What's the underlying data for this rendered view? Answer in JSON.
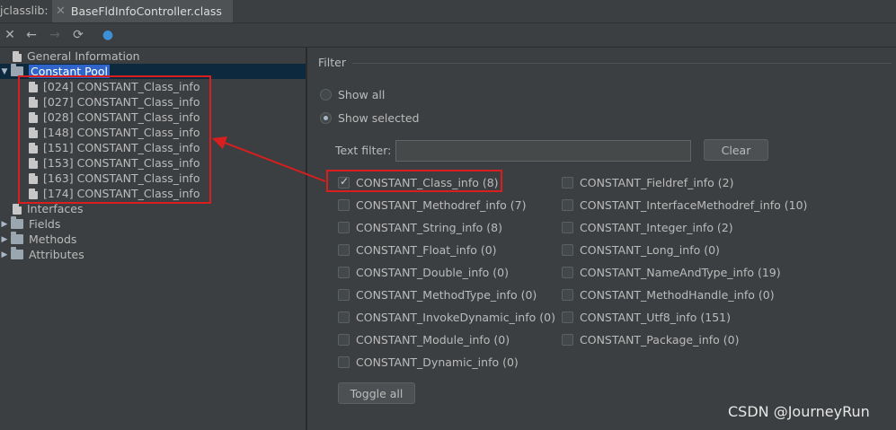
{
  "tabs": {
    "prefix": "jclasslib:",
    "active_title": "BaseFldInfoController.class",
    "close_glyph": "✕"
  },
  "toolbar": {
    "buttons": [
      {
        "name": "close-icon",
        "glyph": "✕"
      },
      {
        "name": "back-arrow-icon",
        "glyph": "←"
      },
      {
        "name": "forward-arrow-icon",
        "glyph": "→"
      },
      {
        "name": "refresh-icon",
        "glyph": "⟳"
      },
      {
        "name": "web-globe-icon",
        "glyph": "●"
      }
    ]
  },
  "tree": {
    "general": "General Information",
    "constant_pool": "Constant Pool",
    "constant_items": [
      "[024] CONSTANT_Class_info",
      "[027] CONSTANT_Class_info",
      "[028] CONSTANT_Class_info",
      "[148] CONSTANT_Class_info",
      "[151] CONSTANT_Class_info",
      "[153] CONSTANT_Class_info",
      "[163] CONSTANT_Class_info",
      "[174] CONSTANT_Class_info"
    ],
    "interfaces": "Interfaces",
    "fields": "Fields",
    "methods": "Methods",
    "attributes": "Attributes"
  },
  "filter": {
    "title": "Filter",
    "show_all": "Show all",
    "show_selected": "Show selected",
    "selected_mode": "show_selected",
    "text_filter_label": "Text filter:",
    "text_filter_value": "",
    "clear_label": "Clear",
    "toggle_all_label": "Toggle all",
    "left_column": [
      {
        "label": "CONSTANT_Class_info (8)",
        "checked": true
      },
      {
        "label": "CONSTANT_Methodref_info (7)",
        "checked": false
      },
      {
        "label": "CONSTANT_String_info (8)",
        "checked": false
      },
      {
        "label": "CONSTANT_Float_info (0)",
        "checked": false
      },
      {
        "label": "CONSTANT_Double_info (0)",
        "checked": false
      },
      {
        "label": "CONSTANT_MethodType_info (0)",
        "checked": false
      },
      {
        "label": "CONSTANT_InvokeDynamic_info (0)",
        "checked": false
      },
      {
        "label": "CONSTANT_Module_info (0)",
        "checked": false
      },
      {
        "label": "CONSTANT_Dynamic_info (0)",
        "checked": false
      }
    ],
    "right_column": [
      {
        "label": "CONSTANT_Fieldref_info (2)",
        "checked": false
      },
      {
        "label": "CONSTANT_InterfaceMethodref_info (10)",
        "checked": false
      },
      {
        "label": "CONSTANT_Integer_info (2)",
        "checked": false
      },
      {
        "label": "CONSTANT_Long_info (0)",
        "checked": false
      },
      {
        "label": "CONSTANT_NameAndType_info (19)",
        "checked": false
      },
      {
        "label": "CONSTANT_MethodHandle_info (0)",
        "checked": false
      },
      {
        "label": "CONSTANT_Utf8_info (151)",
        "checked": false
      },
      {
        "label": "CONSTANT_Package_info (0)",
        "checked": false
      }
    ]
  },
  "watermark": "CSDN @JourneyRun",
  "colors": {
    "annotation_red": "#d81e1e",
    "selection_blue": "#2f65ca",
    "panel_bg": "#3c3f41"
  }
}
